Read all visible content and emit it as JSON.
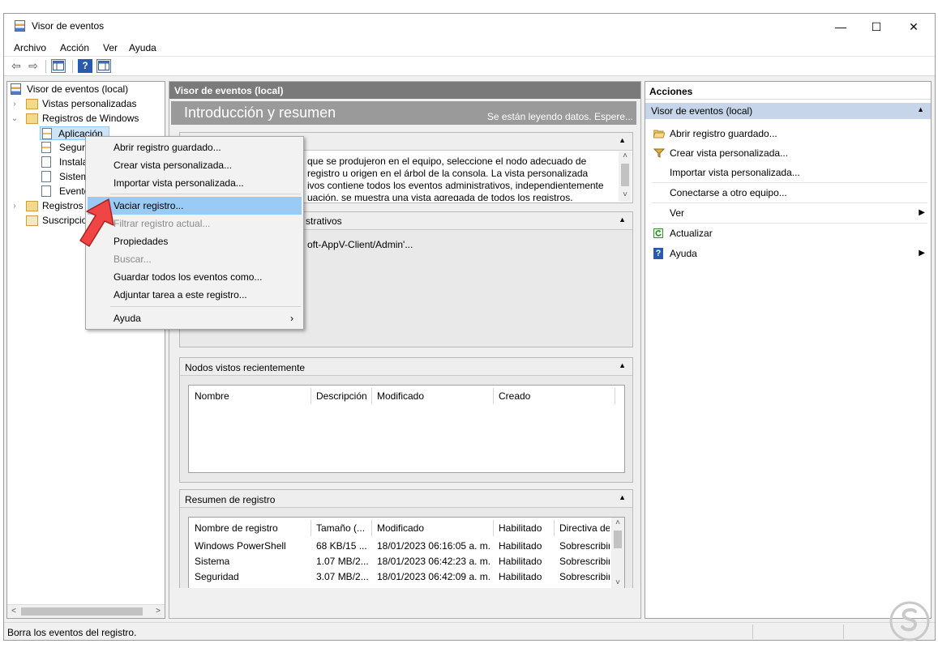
{
  "window": {
    "title": "Visor de eventos",
    "controls": {
      "minimize": "—",
      "maximize": "☐",
      "close": "✕"
    }
  },
  "menubar": [
    "Archivo",
    "Acción",
    "Ver",
    "Ayuda"
  ],
  "toolbar": {
    "back": "⇦",
    "forward": "⇨"
  },
  "tree": {
    "root": "Visor de eventos (local)",
    "items": [
      {
        "label": "Vistas personalizadas",
        "icon": "folder-icon"
      },
      {
        "label": "Registros de Windows",
        "icon": "folder-icon"
      },
      {
        "label": "Aplicación",
        "icon": "log-icon"
      },
      {
        "label": "Seguri",
        "icon": "log-icon"
      },
      {
        "label": "Instala",
        "icon": "log-icon"
      },
      {
        "label": "Sistem",
        "icon": "log-icon"
      },
      {
        "label": "Evento",
        "icon": "log-icon"
      },
      {
        "label": "Registros d",
        "icon": "folder-icon"
      },
      {
        "label": "Suscripcio",
        "icon": "subscription-icon"
      }
    ]
  },
  "center": {
    "header": "Visor de eventos (local)",
    "banner_title": "Introducción y resumen",
    "banner_status": "Se están leyendo datos. Espere...",
    "overview": {
      "lines": [
        "que se produjeron en el equipo, seleccione el nodo adecuado de",
        "registro u origen en el árbol de la consola. La vista personalizada",
        "ivos contiene todos los eventos administrativos, independientemente",
        "uación, se muestra una vista agregada de todos los registros."
      ]
    },
    "admin_section": {
      "title": "strativos",
      "row": "oft-AppV-Client/Admin'..."
    },
    "recent": {
      "title": "Nodos vistos recientemente",
      "columns": [
        "Nombre",
        "Descripción",
        "Modificado",
        "Creado"
      ]
    },
    "summary": {
      "title": "Resumen de registro",
      "columns": [
        "Nombre de registro",
        "Tamaño (...",
        "Modificado",
        "Habilitado",
        "Directiva de"
      ],
      "rows": [
        [
          "Windows PowerShell",
          "68 KB/15 ...",
          "18/01/2023 06:16:05 a. m.",
          "Habilitado",
          "Sobrescribir"
        ],
        [
          "Sistema",
          "1.07 MB/2...",
          "18/01/2023 06:42:23 a. m.",
          "Habilitado",
          "Sobrescribir"
        ],
        [
          "Seguridad",
          "3.07 MB/2...",
          "18/01/2023 06:42:09 a. m.",
          "Habilitado",
          "Sobrescribir"
        ]
      ]
    }
  },
  "context_menu": {
    "items": [
      {
        "label": "Abrir registro guardado...",
        "state": "normal"
      },
      {
        "label": "Crear vista personalizada...",
        "state": "normal"
      },
      {
        "label": "Importar vista personalizada...",
        "state": "normal"
      },
      {
        "label": "Vaciar registro...",
        "state": "highlighted"
      },
      {
        "label": "Filtrar registro actual...",
        "state": "disabled"
      },
      {
        "label": "Propiedades",
        "state": "normal"
      },
      {
        "label": "Buscar...",
        "state": "disabled"
      },
      {
        "label": "Guardar todos los eventos como...",
        "state": "normal"
      },
      {
        "label": "Adjuntar tarea a este registro...",
        "state": "normal"
      },
      {
        "label": "Ayuda",
        "state": "normal",
        "submenu": "›"
      }
    ]
  },
  "actions": {
    "header": "Acciones",
    "group": "Visor de eventos (local)",
    "group_caret": "▲",
    "items": [
      {
        "label": "Abrir registro guardado...",
        "icon": "open-folder-icon"
      },
      {
        "label": "Crear vista personalizada...",
        "icon": "filter-icon"
      },
      {
        "label": "Importar vista personalizada...",
        "icon": ""
      },
      {
        "label": "Conectarse a otro equipo...",
        "icon": ""
      },
      {
        "label": "Ver",
        "icon": "",
        "submenu": "▶"
      },
      {
        "label": "Actualizar",
        "icon": "refresh-icon"
      },
      {
        "label": "Ayuda",
        "icon": "help-icon",
        "submenu": "▶"
      }
    ]
  },
  "statusbar": "Borra los eventos del registro.",
  "colors": {
    "highlight": "#99cbf5",
    "group_header": "#c6d5ea",
    "center_header": "#7a7a7a",
    "banner": "#9a9a9a",
    "cursor_arrow": "#f04545"
  }
}
